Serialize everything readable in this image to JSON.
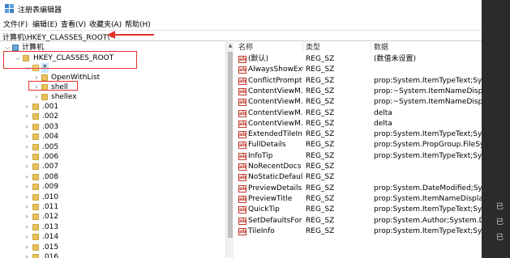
{
  "window": {
    "title": "注册表编辑器",
    "icon": "registry-editor-icon"
  },
  "menu": [
    "文件(F)",
    "编辑(E)",
    "查看(V)",
    "收藏夹(A)",
    "帮助(H)"
  ],
  "address": {
    "path": "计算机\\HKEY_CLASSES_ROOT\\*"
  },
  "tree": {
    "root_label": "计算机",
    "hkcr_label": "HKEY_CLASSES_ROOT",
    "star_label": "*",
    "star_children": [
      "OpenWithList",
      "shell",
      "shellex"
    ],
    "extensions": [
      ".001",
      ".002",
      ".003",
      ".004",
      ".005",
      ".006",
      ".007",
      ".008",
      ".009",
      ".010",
      ".011",
      ".012",
      ".013",
      ".014",
      ".015",
      ".016"
    ]
  },
  "list": {
    "headers": {
      "name": "名称",
      "type": "类型",
      "data": "数据"
    },
    "rows": [
      {
        "name": "(默认)",
        "type": "REG_SZ",
        "data": "(数值未设置)"
      },
      {
        "name": "AlwaysShowExt",
        "type": "REG_SZ",
        "data": ""
      },
      {
        "name": "ConflictPrompt",
        "type": "REG_SZ",
        "data": "prop:System.ItemTypeText;Syste"
      },
      {
        "name": "ContentViewM...",
        "type": "REG_SZ",
        "data": "prop:~System.ItemNameDisplay"
      },
      {
        "name": "ContentViewM...",
        "type": "REG_SZ",
        "data": "prop:~System.ItemNameDisplay"
      },
      {
        "name": "ContentViewM...",
        "type": "REG_SZ",
        "data": "delta"
      },
      {
        "name": "ContentViewM...",
        "type": "REG_SZ",
        "data": "delta"
      },
      {
        "name": "ExtendedTileIn...",
        "type": "REG_SZ",
        "data": "prop:System.ItemTypeText;Syste"
      },
      {
        "name": "FullDetails",
        "type": "REG_SZ",
        "data": "prop:System.PropGroup.FileSyst"
      },
      {
        "name": "InfoTip",
        "type": "REG_SZ",
        "data": "prop:System.ItemTypeText;Syste"
      },
      {
        "name": "NoRecentDocs",
        "type": "REG_SZ",
        "data": ""
      },
      {
        "name": "NoStaticDefaul...",
        "type": "REG_SZ",
        "data": ""
      },
      {
        "name": "PreviewDetails",
        "type": "REG_SZ",
        "data": "prop:System.DateModified;Syste"
      },
      {
        "name": "PreviewTitle",
        "type": "REG_SZ",
        "data": "prop:System.ItemNameDisplay;S"
      },
      {
        "name": "QuickTip",
        "type": "REG_SZ",
        "data": "prop:System.ItemTypeText;Syste"
      },
      {
        "name": "SetDefaultsFor",
        "type": "REG_SZ",
        "data": "prop:System.Author;System.Doc"
      },
      {
        "name": "TileInfo",
        "type": "REG_SZ",
        "data": "prop:System.ItemTypeText;Syste"
      }
    ]
  },
  "side_text": [
    "已",
    "已",
    "已"
  ],
  "colors": {
    "highlight_red": "#e5322d",
    "selection": "#cce8ff",
    "folder": "#e8c15a"
  }
}
